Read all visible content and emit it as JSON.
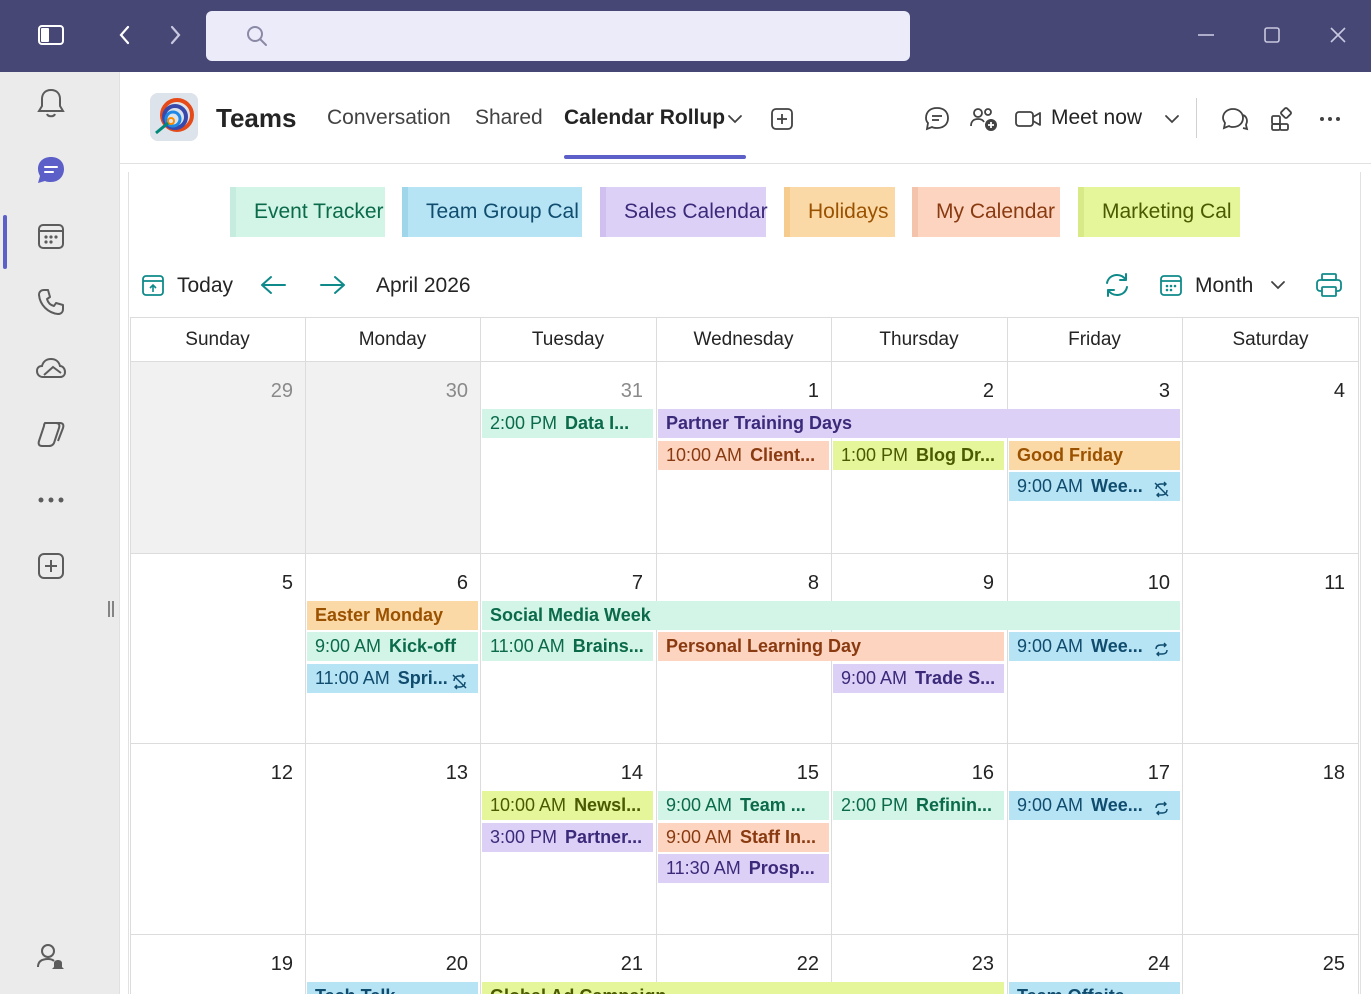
{
  "colors": {
    "titlebar": "#464775",
    "accent": "#5b5fc7",
    "teal_icon": "#0f8a8a"
  },
  "search": {
    "placeholder": ""
  },
  "header": {
    "team_name": "Teams",
    "tabs": [
      "Conversation",
      "Shared",
      "Calendar Rollup"
    ],
    "meet_now": "Meet now"
  },
  "chips": [
    "Event Tracker",
    "Team Group Cal",
    "Sales Calendar",
    "Holidays",
    "My Calendar",
    "Marketing Cal"
  ],
  "toolbar": {
    "today": "Today",
    "month_label": "April 2026",
    "view": "Month"
  },
  "calendar": {
    "days_of_week": [
      "Sunday",
      "Monday",
      "Tuesday",
      "Wednesday",
      "Thursday",
      "Friday",
      "Saturday"
    ],
    "weeks": [
      [
        "29",
        "30",
        "31",
        "1",
        "2",
        "3",
        "4"
      ],
      [
        "5",
        "6",
        "7",
        "8",
        "9",
        "10",
        "11"
      ],
      [
        "12",
        "13",
        "14",
        "15",
        "16",
        "17",
        "18"
      ],
      [
        "19",
        "20",
        "21",
        "22",
        "23",
        "24",
        "25"
      ]
    ],
    "events": {
      "w1_tue": {
        "time": "2:00 PM",
        "name": "Data I..."
      },
      "w1_partner": {
        "name": "Partner Training Days"
      },
      "w1_wed": {
        "time": "10:00 AM",
        "name": "Client..."
      },
      "w1_thu": {
        "time": "1:00 PM",
        "name": "Blog Dr..."
      },
      "w1_fri_holiday": {
        "name": "Good Friday"
      },
      "w1_fri": {
        "time": "9:00 AM",
        "name": "Wee..."
      },
      "w2_easter": {
        "name": "Easter Monday"
      },
      "w2_mon1": {
        "time": "9:00 AM",
        "name": "Kick-off"
      },
      "w2_mon2": {
        "time": "11:00 AM",
        "name": "Spri..."
      },
      "w2_social": {
        "name": "Social Media Week"
      },
      "w2_tue": {
        "time": "11:00 AM",
        "name": "Brains..."
      },
      "w2_learning": {
        "name": "Personal Learning Day"
      },
      "w2_fri": {
        "time": "9:00 AM",
        "name": "Wee..."
      },
      "w2_thu": {
        "time": "9:00 AM",
        "name": "Trade S..."
      },
      "w3_tue1": {
        "time": "10:00 AM",
        "name": "Newsl..."
      },
      "w3_tue2": {
        "time": "3:00 PM",
        "name": "Partner..."
      },
      "w3_wed1": {
        "time": "9:00 AM",
        "name": "Team ..."
      },
      "w3_wed2": {
        "time": "9:00 AM",
        "name": "Staff In..."
      },
      "w3_wed3": {
        "time": "11:30 AM",
        "name": "Prosp..."
      },
      "w3_thu": {
        "time": "2:00 PM",
        "name": "Refinin..."
      },
      "w3_fri": {
        "time": "9:00 AM",
        "name": "Wee..."
      },
      "w4_mon": {
        "name": "Tech Talk"
      },
      "w4_tue": {
        "name": "Global Ad Campaign"
      },
      "w4_fri": {
        "name": "Team Offsite"
      }
    }
  }
}
